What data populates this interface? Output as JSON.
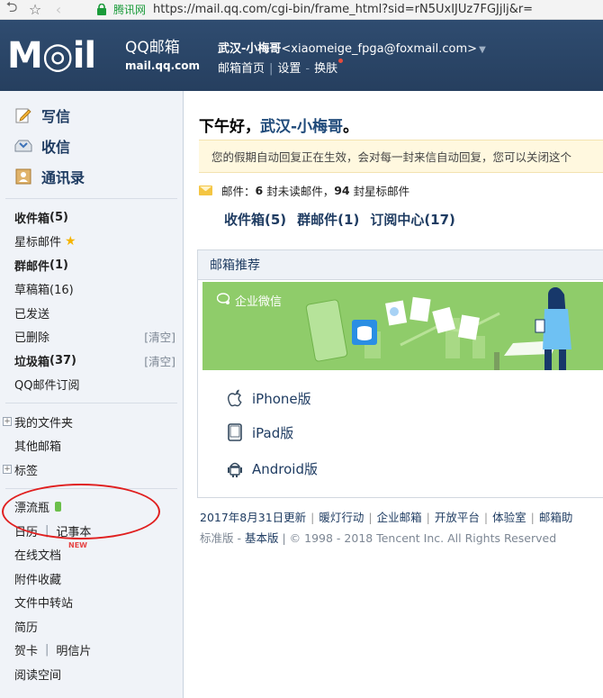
{
  "browser": {
    "site_name": "腾讯网",
    "url": "https://mail.qq.com/cgi-bin/frame_html?sid=rN5UxIJUz7FGJjlj&r="
  },
  "header": {
    "logo_text": "M◎il",
    "product_name": "QQ邮箱",
    "domain": "mail.qq.com",
    "account_name": "武汉-小梅哥",
    "account_email": "<xiaomeige_fpga@foxmail.com>",
    "links": [
      "邮箱首页",
      "设置",
      "换肤"
    ]
  },
  "sidebar": {
    "actions": [
      "写信",
      "收信",
      "通讯录"
    ],
    "folders": {
      "inbox": "收件箱",
      "inbox_count": "(5)",
      "starred": "星标邮件",
      "group": "群邮件",
      "group_count": "(1)",
      "drafts": "草稿箱(16)",
      "sent": "已发送",
      "deleted": "已删除",
      "spam": "垃圾箱",
      "spam_count": "(37)",
      "clear": "[清空]",
      "subscription": "QQ邮件订阅"
    },
    "my_folders": "我的文件夹",
    "other_mailbox": "其他邮箱",
    "tags": "标签",
    "tools": {
      "drift_bottle": "漂流瓶",
      "calendar": "日历",
      "notes": "记事本",
      "new_tag": "NEW",
      "online_docs": "在线文档",
      "attachments": "附件收藏",
      "file_transfer": "文件中转站",
      "resume": "简历",
      "greeting_card": "贺卡",
      "postcard": "明信片",
      "reading": "阅读空间"
    }
  },
  "main": {
    "greeting_prefix": "下午好，",
    "greeting_name": "武汉-小梅哥",
    "greeting_suffix": "。",
    "notice": "您的假期自动回复正在生效，会对每一封来信自动回复，您可以关闭这个",
    "stats": {
      "label": "邮件：",
      "unread_count": "6",
      "unread_text": "封未读邮件，",
      "starred_count": "94",
      "starred_text": "封星标邮件"
    },
    "quick_links": [
      "收件箱(5)",
      "群邮件(1)",
      "订阅中心(17)"
    ],
    "recommend": {
      "title": "邮箱推荐",
      "banner_label": "企业微信",
      "apps": [
        "iPhone版",
        "iPad版",
        "Android版"
      ]
    },
    "footer_links": [
      "2017年8月31日更新",
      "暖灯行动",
      "企业邮箱",
      "开放平台",
      "体验室",
      "邮箱助"
    ],
    "footer_version": "标准版",
    "footer_basic": "基本版",
    "footer_copyright": "© 1998 - 2018 Tencent Inc. All Rights Reserved"
  }
}
